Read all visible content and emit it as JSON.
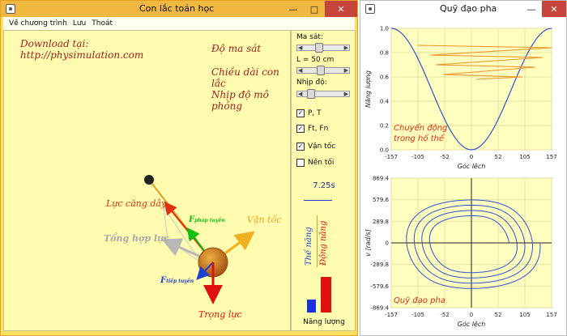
{
  "left_window": {
    "title": "Con lắc toán học",
    "menu": [
      "Về chương trình",
      "Lưu",
      "Thoát"
    ],
    "download_label": "Download tại:",
    "download_url": "http://physimulation.com",
    "labels": {
      "friction": "Độ ma sát",
      "length": "Chiều dài con lắc",
      "rate": "Nhịp độ mô phỏng"
    },
    "forces": {
      "tension": "Lực căng dây",
      "normal_prefix": "F",
      "normal_sub": "pháp tuyến",
      "velocity": "Vận tốc",
      "net": "Tổng hợp lực",
      "tangent_prefix": "F",
      "tangent_sub": "tiếp tuyến",
      "gravity": "Trọng lực"
    },
    "controls": {
      "friction_label": "Ma sát:",
      "length_label": "L = 50 cm",
      "rate_label": "Nhịp độ:",
      "checkboxes": [
        {
          "label": "P, T",
          "checked": true
        },
        {
          "label": "Ft, Fn",
          "checked": true
        },
        {
          "label": "Vận tốc",
          "checked": true
        },
        {
          "label": "Nền tối",
          "checked": false
        }
      ],
      "time": "7.25s",
      "potential_label": "Thế năng",
      "kinetic_label": "Động năng",
      "energy_label": "Năng lượng",
      "energy": {
        "potential": 0.27,
        "kinetic": 0.73
      }
    },
    "colors": {
      "tension": "#e03010",
      "normal": "#10c010",
      "velocity": "#f0b020",
      "net": "#b8b8b8",
      "tangent": "#2040d0",
      "gravity": "#e01010",
      "bob": "#c06010"
    }
  },
  "right_window": {
    "title": "Quỹ đạo pha",
    "top_plot": {
      "ylabel": "Năng lượng",
      "xlabel": "Góc lệch",
      "xticks": [
        "-157",
        "-105",
        "-52",
        "0",
        "52",
        "105",
        "157"
      ],
      "yticks": [
        "0.0",
        "0.2",
        "0.4",
        "0.6",
        "0.8",
        "1.0"
      ],
      "annotation_line1": "Chuyển động",
      "annotation_line2": "trong hố thế"
    },
    "bottom_plot": {
      "ylabel": "v [rad/s]",
      "xlabel": "Góc lệch",
      "xticks": [
        "-157",
        "-105",
        "-52",
        "0",
        "52",
        "105",
        "157"
      ],
      "yticks": [
        "869.4",
        "579.6",
        "289.8",
        "0",
        "-289.8",
        "-579.6",
        "-869.4"
      ],
      "annotation": "Quỹ đạo pha"
    }
  },
  "chart_data": [
    {
      "type": "line",
      "title": "",
      "xlabel": "Góc lệch",
      "ylabel": "Năng lượng",
      "xlim": [
        -157,
        157
      ],
      "ylim": [
        0,
        1.0
      ],
      "series": [
        {
          "values_x": [
            -157,
            -105,
            -52,
            0,
            52,
            105,
            157
          ],
          "values_y": [
            1.0,
            0.63,
            0.18,
            0.0,
            0.18,
            0.63,
            1.0
          ]
        },
        {
          "values_x": [
            -105,
            157,
            -80,
            140,
            -70,
            125,
            -55,
            100,
            10
          ],
          "values_y": [
            0.86,
            0.84,
            0.78,
            0.76,
            0.7,
            0.68,
            0.62,
            0.6,
            0.58
          ]
        }
      ]
    },
    {
      "type": "line",
      "title": "",
      "xlabel": "Góc lệch",
      "ylabel": "v [rad/s]",
      "xlim": [
        -157,
        157
      ],
      "ylim": [
        -869.4,
        869.4
      ],
      "series": [
        {
          "values_x": [
            -120,
            0,
            120,
            0,
            -120
          ],
          "values_y": [
            0,
            580,
            0,
            -580,
            0
          ]
        }
      ]
    }
  ]
}
